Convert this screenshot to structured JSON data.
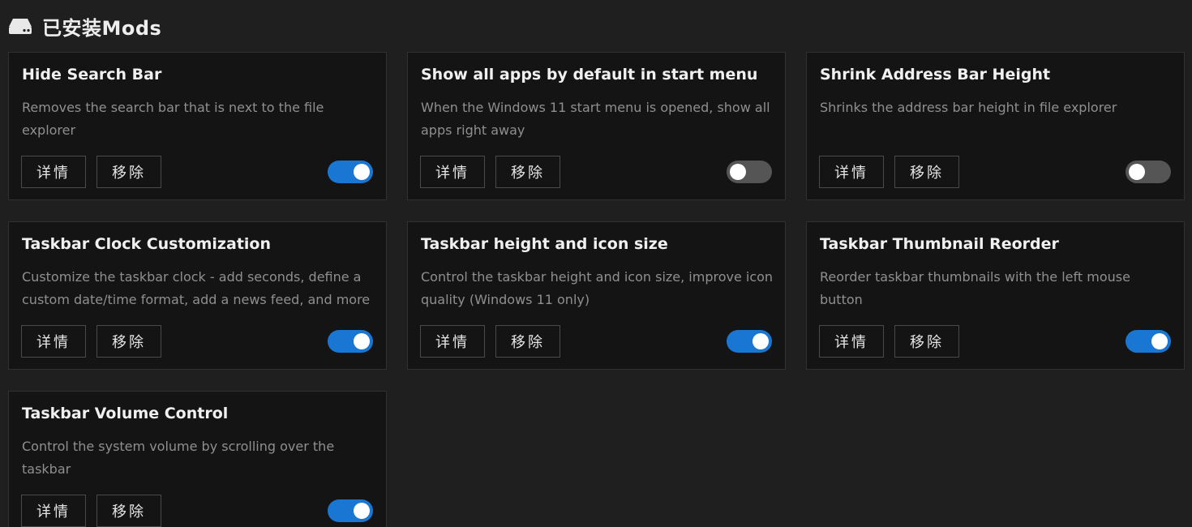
{
  "header": {
    "title": "已安装Mods",
    "icon": "hard-drive-icon"
  },
  "buttons": {
    "details_label": "详情",
    "remove_label": "移除"
  },
  "colors": {
    "toggle_on": "#1976d2",
    "toggle_off": "#555555"
  },
  "mods": [
    {
      "title": "Hide Search Bar",
      "description": "Removes the search bar that is next to the file explorer",
      "enabled": true
    },
    {
      "title": "Show all apps by default in start menu",
      "description": "When the Windows 11 start menu is opened, show all apps right away",
      "enabled": false
    },
    {
      "title": "Shrink Address Bar Height",
      "description": "Shrinks the address bar height in file explorer",
      "enabled": false
    },
    {
      "title": "Taskbar Clock Customization",
      "description": "Customize the taskbar clock - add seconds, define a custom date/time format, add a news feed, and more",
      "enabled": true
    },
    {
      "title": "Taskbar height and icon size",
      "description": "Control the taskbar height and icon size, improve icon quality (Windows 11 only)",
      "enabled": true
    },
    {
      "title": "Taskbar Thumbnail Reorder",
      "description": "Reorder taskbar thumbnails with the left mouse button",
      "enabled": true
    },
    {
      "title": "Taskbar Volume Control",
      "description": "Control the system volume by scrolling over the taskbar",
      "enabled": true
    }
  ]
}
